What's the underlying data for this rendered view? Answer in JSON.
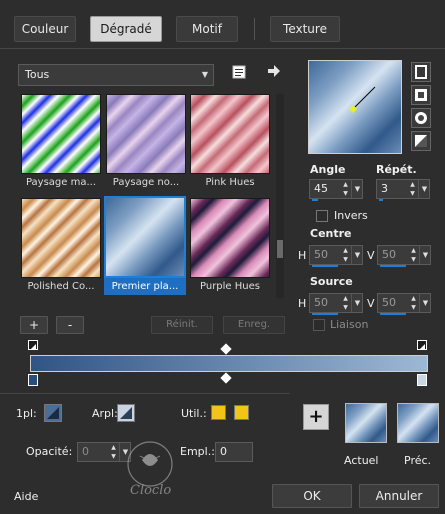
{
  "tabs": [
    "Couleur",
    "Dégradé",
    "Motif",
    "Texture"
  ],
  "active_tab": "Dégradé",
  "category": "Tous",
  "thumbnails": [
    {
      "label": "Paysage ma..."
    },
    {
      "label": "Paysage no..."
    },
    {
      "label": "Pink Hues"
    },
    {
      "label": "Polished Co..."
    },
    {
      "label": "Premier pla...",
      "selected": true
    },
    {
      "label": "Purple Hues"
    }
  ],
  "list_buttons": {
    "add": "+",
    "remove": "-",
    "reset": "Réinit.",
    "save": "Enreg."
  },
  "angle": {
    "label": "Angle",
    "value": "45"
  },
  "repeat": {
    "label": "Répét.",
    "value": "3"
  },
  "invert": {
    "label": "Invers",
    "checked": false
  },
  "center": {
    "label": "Centre",
    "h_label": "H",
    "h": "50",
    "v_label": "V",
    "v": "50"
  },
  "source": {
    "label": "Source",
    "h_label": "H",
    "h": "50",
    "v_label": "V",
    "v": "50"
  },
  "link": {
    "label": "Liaison",
    "checked": false
  },
  "stop_controls": {
    "first_plan_label": "1pl:",
    "arrplan_label": "Arpl:",
    "util_label": "Util.:",
    "opacity_label": "Opacité:",
    "opacity_value": "0",
    "position_label": "Empl.:",
    "position_value": "0"
  },
  "previews": {
    "current_label": "Actuel",
    "previous_label": "Préc."
  },
  "footer": {
    "help": "Aide",
    "ok": "OK",
    "cancel": "Annuler"
  },
  "colors": {
    "accent": "#1e7fd6",
    "swatch_yellow": "#f2c318",
    "stop_marker_dark": "#2a4f7c"
  }
}
